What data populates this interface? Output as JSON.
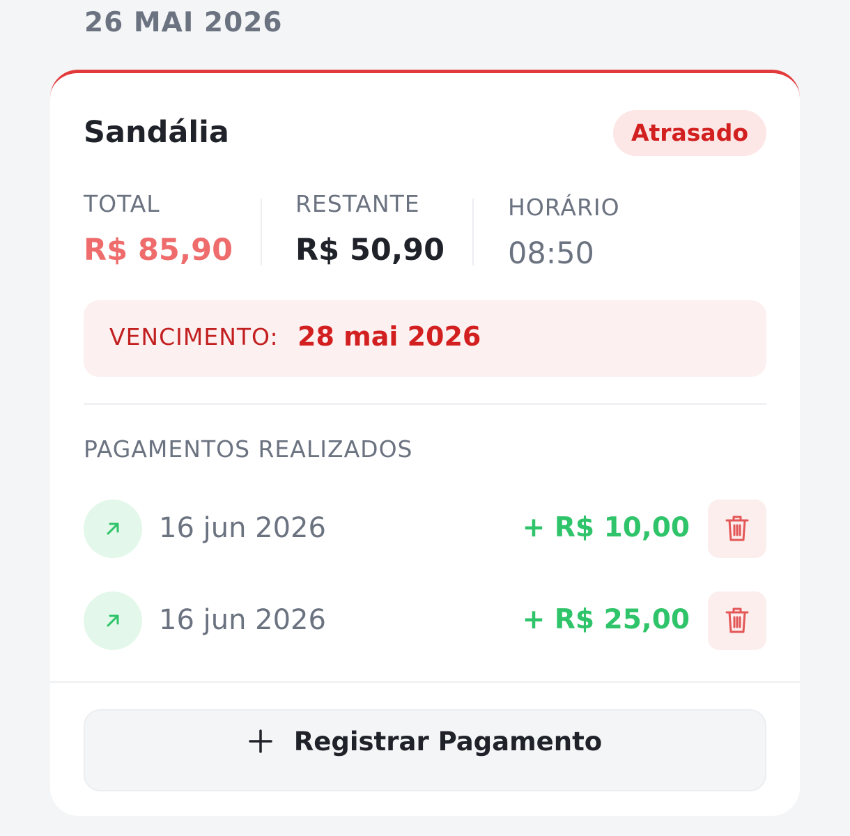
{
  "section_date": "26 MAI 2026",
  "card": {
    "title": "Sandália",
    "status": "Atrasado",
    "total": {
      "label": "TOTAL",
      "value": "R$ 85,90"
    },
    "remaining": {
      "label": "RESTANTE",
      "value": "R$ 50,90"
    },
    "time": {
      "label": "HORÁRIO",
      "value": "08:50"
    },
    "due": {
      "label": "VENCIMENTO:",
      "value": "28 mai 2026"
    },
    "payments_title": "PAGAMENTOS REALIZADOS",
    "payments": [
      {
        "date": "16 jun 2026",
        "amount": "+ R$ 10,00",
        "icon": "arrow-up-right-icon"
      },
      {
        "date": "16 jun 2026",
        "amount": "+ R$ 25,00",
        "icon": "arrow-up-right-icon"
      }
    ],
    "register_label": "Registrar Pagamento"
  },
  "colors": {
    "accent_red": "#e23a3a",
    "badge_text": "#d21f1f",
    "success_green": "#2fc46a",
    "muted_text": "#6b7280"
  }
}
